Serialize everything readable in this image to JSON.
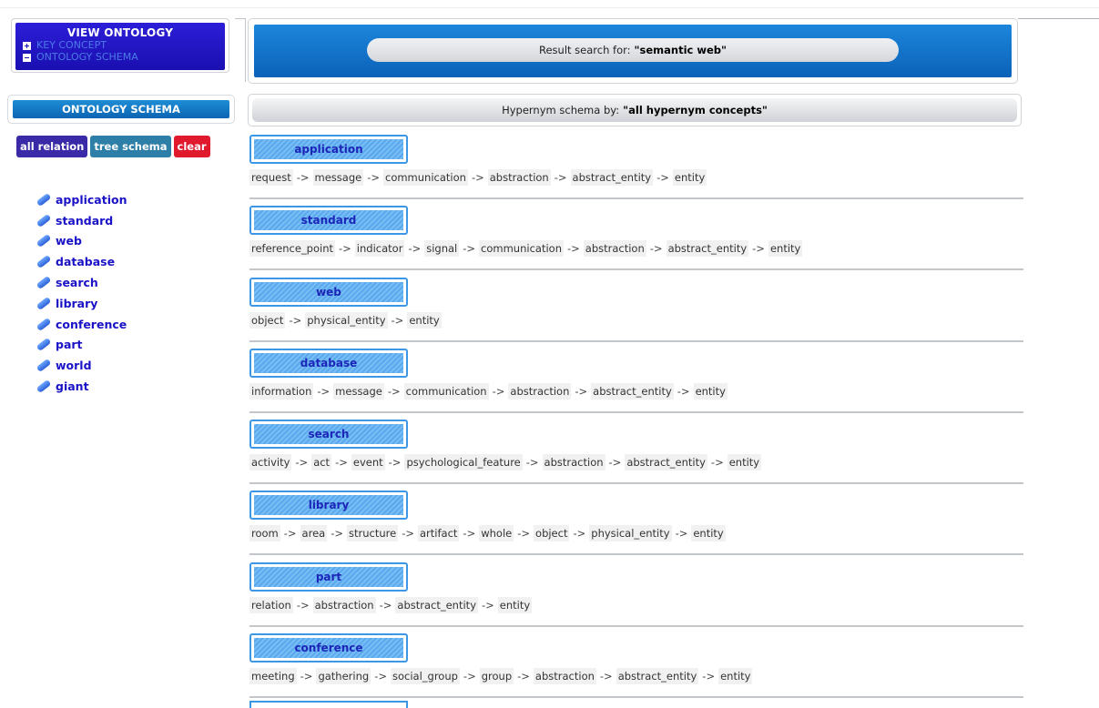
{
  "left": {
    "view_panel": {
      "title": "VIEW ONTOLOGY",
      "items": [
        "KEY CONCEPT",
        "ONTOLOGY SCHEMA"
      ]
    },
    "schema_header": "ONTOLOGY SCHEMA",
    "buttons": {
      "all": "all relation",
      "tree": "tree schema",
      "clear": "clear"
    },
    "concepts": [
      "application",
      "standard",
      "web",
      "database",
      "search",
      "library",
      "conference",
      "part",
      "world",
      "giant"
    ]
  },
  "result": {
    "prefix": "Result search for:",
    "query": "\"semantic web\""
  },
  "hypernym": {
    "prefix": "Hypernym schema by:",
    "value": "\"all hypernym concepts\""
  },
  "results": [
    {
      "concept": "application",
      "path": [
        "request",
        "message",
        "communication",
        "abstraction",
        "abstract_entity",
        "entity"
      ]
    },
    {
      "concept": "standard",
      "path": [
        "reference_point",
        "indicator",
        "signal",
        "communication",
        "abstraction",
        "abstract_entity",
        "entity"
      ]
    },
    {
      "concept": "web",
      "path": [
        "object",
        "physical_entity",
        "entity"
      ]
    },
    {
      "concept": "database",
      "path": [
        "information",
        "message",
        "communication",
        "abstraction",
        "abstract_entity",
        "entity"
      ]
    },
    {
      "concept": "search",
      "path": [
        "activity",
        "act",
        "event",
        "psychological_feature",
        "abstraction",
        "abstract_entity",
        "entity"
      ]
    },
    {
      "concept": "library",
      "path": [
        "room",
        "area",
        "structure",
        "artifact",
        "whole",
        "object",
        "physical_entity",
        "entity"
      ]
    },
    {
      "concept": "part",
      "path": [
        "relation",
        "abstraction",
        "abstract_entity",
        "entity"
      ]
    },
    {
      "concept": "conference",
      "path": [
        "meeting",
        "gathering",
        "social_group",
        "group",
        "abstraction",
        "abstract_entity",
        "entity"
      ]
    }
  ],
  "arrow": "->",
  "colors": {
    "accent_blue": "#0b62b8",
    "button_purple": "#3a2aa8",
    "button_teal": "#2d7fa8",
    "button_red": "#e0192d",
    "link_blue": "#1a12c6"
  }
}
